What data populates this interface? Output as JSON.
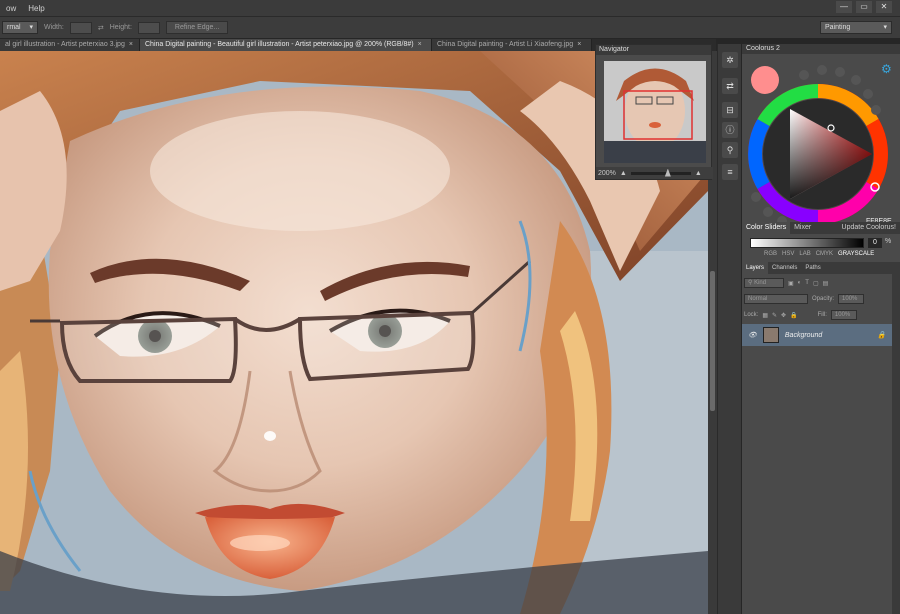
{
  "menubar": {
    "items": [
      "ow",
      "Help"
    ]
  },
  "window_buttons": [
    "—",
    "▭",
    "✕"
  ],
  "options_bar": {
    "mode_value": "rmal",
    "width_label": "Width:",
    "height_label": "Height:",
    "refine_edge_label": "Refine Edge...",
    "workspace_value": "Painting"
  },
  "tabs": [
    {
      "label": "al girl illustration - Artist peterxiao 3.jpg",
      "active": false
    },
    {
      "label": "China Digital painting - Beautiful girl illustration - Artist peterxiao.jpg @ 200% (RGB/8#)",
      "active": true
    },
    {
      "label": "China Digital painting - Artist Li Xiaofeng.jpg",
      "active": false
    }
  ],
  "navigator": {
    "title": "Navigator",
    "zoom_value": "200%"
  },
  "coolorus": {
    "title": "Coolorus 2",
    "current_color": "#ff8e8e",
    "hex_value": "FF8E8E"
  },
  "color_tabs": [
    "Color Sliders",
    "Mixer",
    "Update Coolorus!"
  ],
  "grayscale": {
    "value": "0",
    "unit": "%"
  },
  "color_modes": [
    "RGB",
    "HSV",
    "LAB",
    "CMYK",
    "GRAYSCALE"
  ],
  "layers": {
    "tabs": [
      "Layers",
      "Channels",
      "Paths"
    ],
    "kind_label": "Kind",
    "blend_mode": "Normal",
    "opacity_label": "Opacity:",
    "opacity_value": "100%",
    "lock_label": "Lock:",
    "fill_label": "Fill:",
    "fill_value": "100%",
    "background_layer_name": "Background"
  },
  "colors": {
    "accent_layer": "#5b6d80",
    "nav_box": "#e03030"
  }
}
